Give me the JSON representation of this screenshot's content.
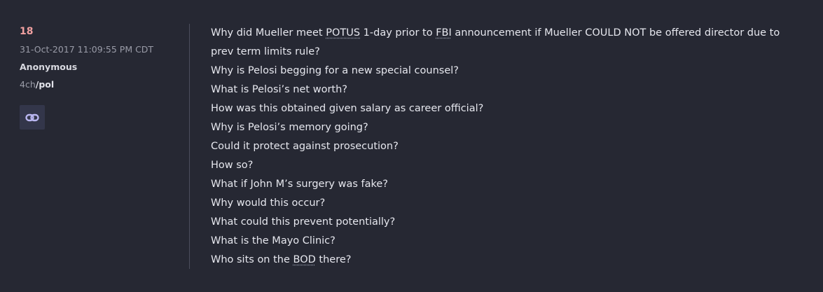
{
  "post": {
    "number": "18",
    "timestamp": "31-Oct-2017 11:09:55 PM CDT",
    "author": "Anonymous",
    "source_prefix": "4ch",
    "source_board": "/pol",
    "link_icon": "link-icon"
  },
  "message": {
    "line1": {
      "p1": "Why did Mueller meet ",
      "a1": "POTUS",
      "p2": " 1-day prior to ",
      "a2": "FBI",
      "p3": " announcement if Mueller COULD NOT be offered director due to"
    },
    "line2": "prev term limits rule?",
    "line3": "Why is Pelosi begging for a new special counsel?",
    "line4": "What is Pelosi’s net worth?",
    "line5": "How was this obtained given salary as career official?",
    "line6": "Why is Pelosi’s memory going?",
    "line7": "Could it protect against prosecution?",
    "line8": "How so?",
    "line9": "What if John M’s surgery was fake?",
    "line10": "Why would this occur?",
    "line11": "What could this prevent potentially?",
    "line12": "What is the Mayo Clinic?",
    "line13": {
      "p1": "Who sits on the ",
      "a1": "BOD",
      "p2": " there?"
    }
  },
  "colors": {
    "background": "#262833",
    "post_number": "#f0a0a0",
    "icon": "#b9b6f0",
    "text": "#e6e7ee"
  }
}
